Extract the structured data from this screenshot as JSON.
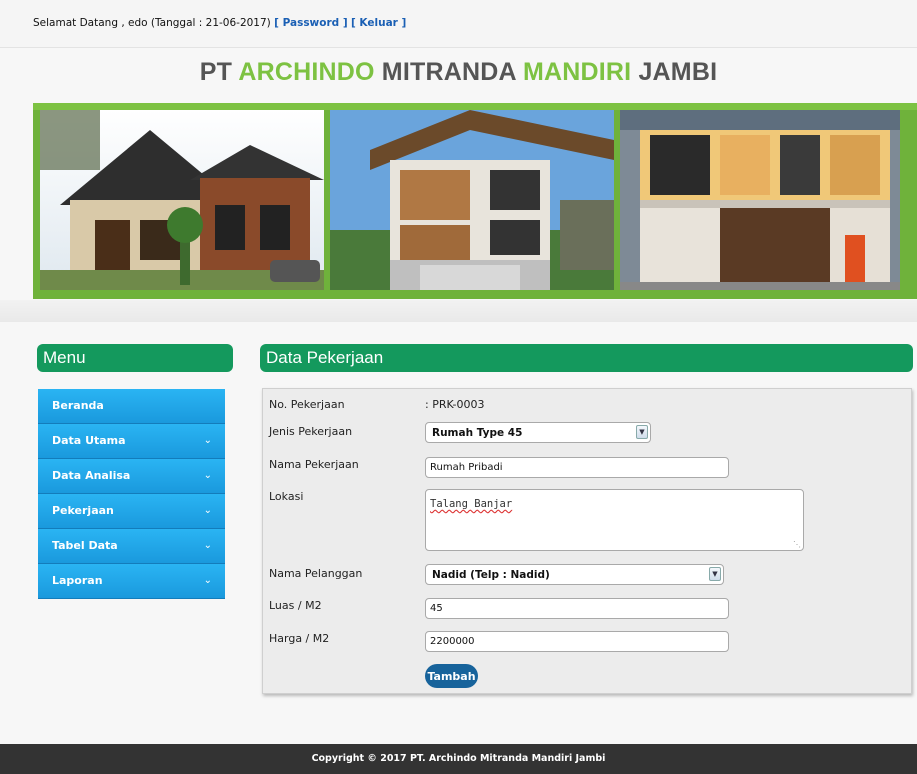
{
  "header": {
    "welcome_text": "Selamat Datang , edo (Tanggal : 21-06-2017)",
    "password_link": "[ Password ]",
    "logout_link": "[ Keluar ]"
  },
  "site": {
    "title_pt": "PT",
    "title_archindo": "ARCHINDO",
    "title_mitranda": "MITRANDA",
    "title_mandiri": "MANDIRI",
    "title_jambi": "JAMBI",
    "accent_color": "#7dc242"
  },
  "menu": {
    "title": "Menu",
    "items": [
      {
        "label": "Beranda",
        "icon": "none"
      },
      {
        "label": "Data Utama",
        "icon": "chevron-down-icon"
      },
      {
        "label": "Data Analisa",
        "icon": "chevron-down-icon"
      },
      {
        "label": "Pekerjaan",
        "icon": "chevron-down-icon"
      },
      {
        "label": "Tabel Data",
        "icon": "chevron-down-icon"
      },
      {
        "label": "Laporan",
        "icon": "chevron-down-icon"
      }
    ]
  },
  "content": {
    "title": "Data Pekerjaan",
    "form": {
      "no_label": "No. Pekerjaan",
      "no_value": ": PRK-0003",
      "jenis_label": "Jenis Pekerjaan",
      "jenis_value": "Rumah Type 45",
      "nama_label": "Nama Pekerjaan",
      "nama_value": "Rumah Pribadi",
      "lokasi_label": "Lokasi",
      "lokasi_value": "Talang Banjar",
      "pelanggan_label": "Nama Pelanggan",
      "pelanggan_value": "Nadid (Telp : Nadid)",
      "luas_label": "Luas / M2",
      "luas_value": "45",
      "harga_label": "Harga / M2",
      "harga_value": "2200000",
      "submit_label": "Tambah"
    }
  },
  "footer": {
    "text": "Copyright © 2017 PT. Archindo Mitranda Mandiri Jambi"
  },
  "colors": {
    "panel_head": "#14995d",
    "menu_item": "#1fa6e8",
    "button": "#17639b",
    "footer_bg": "#333333"
  }
}
